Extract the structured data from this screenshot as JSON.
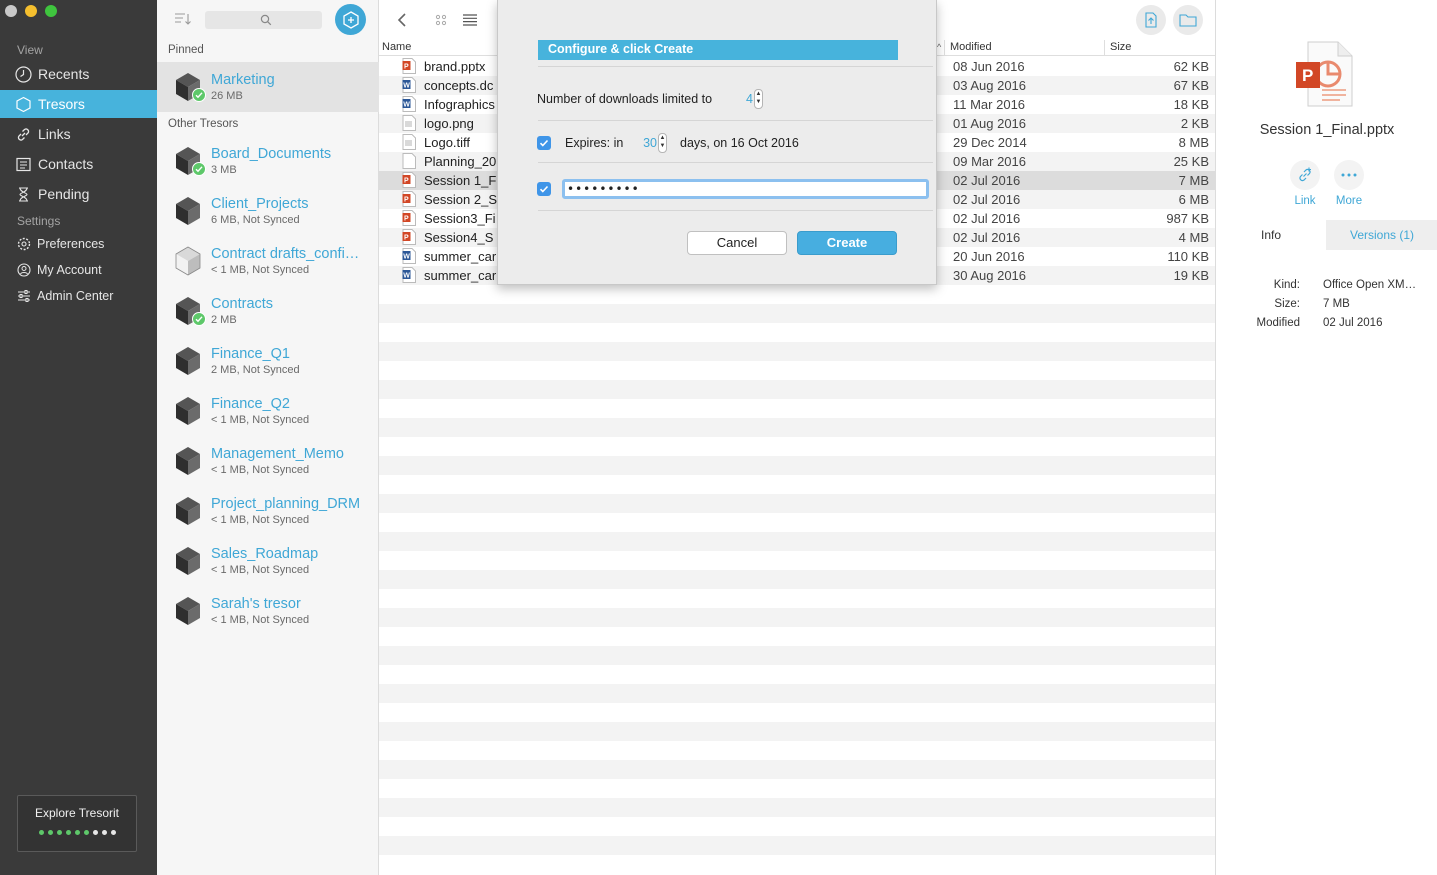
{
  "sidebar": {
    "view_label": "View",
    "settings_label": "Settings",
    "items": [
      {
        "label": "Recents"
      },
      {
        "label": "Tresors"
      },
      {
        "label": "Links"
      },
      {
        "label": "Contacts"
      },
      {
        "label": "Pending"
      }
    ],
    "settings_items": [
      {
        "label": "Preferences"
      },
      {
        "label": "My Account"
      },
      {
        "label": "Admin Center"
      }
    ],
    "explore_label": "Explore Tresorit"
  },
  "tresor_list": {
    "pinned_label": "Pinned",
    "other_label": "Other Tresors",
    "pinned": [
      {
        "name": "Marketing",
        "meta": "26 MB"
      }
    ],
    "others": [
      {
        "name": "Board_Documents",
        "meta": "3 MB"
      },
      {
        "name": "Client_Projects",
        "meta": "6 MB, Not Synced"
      },
      {
        "name": "Contract drafts_confi…",
        "meta": "< 1 MB, Not Synced"
      },
      {
        "name": "Contracts",
        "meta": "2 MB"
      },
      {
        "name": "Finance_Q1",
        "meta": "2 MB, Not Synced"
      },
      {
        "name": "Finance_Q2",
        "meta": "< 1 MB, Not Synced"
      },
      {
        "name": "Management_Memo",
        "meta": "< 1 MB, Not Synced"
      },
      {
        "name": "Project_planning_DRM",
        "meta": "< 1 MB, Not Synced"
      },
      {
        "name": "Sales_Roadmap",
        "meta": "< 1 MB, Not Synced"
      },
      {
        "name": "Sarah's tresor",
        "meta": "< 1 MB, Not Synced"
      }
    ]
  },
  "file_list": {
    "columns": {
      "name": "Name",
      "modified": "Modified",
      "size": "Size"
    },
    "rows": [
      {
        "name": "brand.pptx",
        "modified": "08 Jun 2016",
        "size": "62 KB"
      },
      {
        "name": "concepts.dc",
        "modified": "03 Aug 2016",
        "size": "67 KB"
      },
      {
        "name": "Infographics",
        "modified": "11 Mar 2016",
        "size": "18 KB"
      },
      {
        "name": "logo.png",
        "modified": "01 Aug 2016",
        "size": "2 KB"
      },
      {
        "name": "Logo.tiff",
        "modified": "29 Dec 2014",
        "size": "8 MB"
      },
      {
        "name": "Planning_20",
        "modified": "09 Mar 2016",
        "size": "25 KB"
      },
      {
        "name": "Session 1_F",
        "modified": "02 Jul 2016",
        "size": "7 MB"
      },
      {
        "name": "Session 2_S",
        "modified": "02 Jul 2016",
        "size": "6 MB"
      },
      {
        "name": "Session3_Fi",
        "modified": "02 Jul 2016",
        "size": "987 KB"
      },
      {
        "name": "Session4_S",
        "modified": "02 Jul 2016",
        "size": "4 MB"
      },
      {
        "name": "summer_car",
        "modified": "20 Jun 2016",
        "size": "110 KB"
      },
      {
        "name": "summer_car",
        "modified": "30 Aug 2016",
        "size": "19 KB"
      }
    ]
  },
  "dialog": {
    "title": "Configure & click Create",
    "downloads_label": "Number of downloads limited to",
    "downloads_value": "4",
    "expires_label": "Expires: in",
    "expires_value": "30",
    "expires_suffix": "days, on 16 Oct 2016",
    "password_value": "•••••••••",
    "cancel_label": "Cancel",
    "create_label": "Create"
  },
  "info_panel": {
    "file_name": "Session 1_Final.pptx",
    "link_label": "Link",
    "more_label": "More",
    "tab_info": "Info",
    "tab_versions": "Versions (1)",
    "kind_label": "Kind:",
    "kind_value": "Office Open XM…",
    "size_label": "Size:",
    "size_value": "7 MB",
    "modified_label": "Modified",
    "modified_value": "02 Jul 2016"
  },
  "colors": {
    "accent": "#47b3dc",
    "sidebar_bg": "#3a3a3a",
    "synced_green": "#5ec86a"
  }
}
